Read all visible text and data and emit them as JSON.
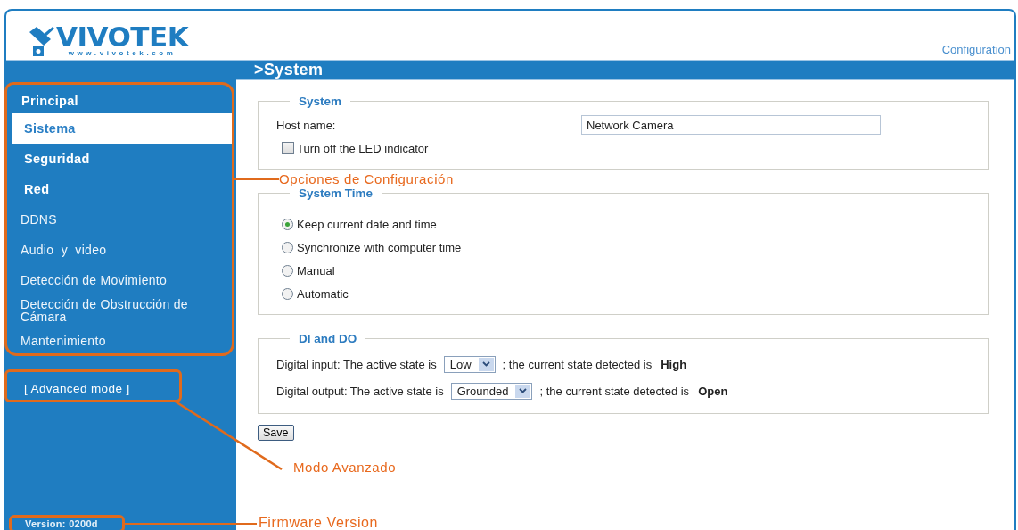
{
  "header": {
    "logo": {
      "name": "VIVOTEK",
      "url": "www.vivotek.com"
    },
    "link": "Configuration"
  },
  "title": ">System",
  "sidebar": {
    "items": [
      {
        "label": "Principal",
        "kind": "header",
        "selected": false
      },
      {
        "label": "Sistema",
        "kind": "group",
        "selected": true
      },
      {
        "label": "Seguridad",
        "kind": "group",
        "selected": false
      },
      {
        "label": "Red",
        "kind": "group",
        "selected": false
      },
      {
        "label": "DDNS",
        "kind": "link",
        "selected": false
      },
      {
        "label": "Audio  y  video",
        "kind": "link",
        "selected": false
      },
      {
        "label": "Detección de Movimiento",
        "kind": "link",
        "selected": false
      },
      {
        "label": "Detección de Obstrucción de Cámara",
        "kind": "link",
        "selected": false
      },
      {
        "label": "Mantenimiento",
        "kind": "link",
        "selected": false
      }
    ],
    "advanced_mode": "[ Advanced mode ]",
    "version": "Version: 0200d"
  },
  "sections": [
    {
      "kind": "system",
      "legend": "System",
      "host_label": "Host name:",
      "host_value": "Network Camera",
      "led": {
        "label": "Turn off the LED indicator",
        "checked": false
      }
    },
    {
      "kind": "time",
      "legend": "System Time",
      "options": [
        {
          "label": "Keep current date and time",
          "selected": true
        },
        {
          "label": "Synchronize with computer time",
          "selected": false
        },
        {
          "label": "Manual",
          "selected": false
        },
        {
          "label": "Automatic",
          "selected": false
        }
      ]
    },
    {
      "kind": "dio",
      "legend": "DI and DO",
      "rows": [
        {
          "label": "Digital input: The active state is",
          "value": "Low",
          "suffix": "; the current state detected is",
          "state": "High"
        },
        {
          "label": "Digital output: The active state is",
          "value": "Grounded",
          "suffix": "; the current state detected is",
          "state": "Open"
        }
      ]
    }
  ],
  "save": "Save",
  "annotations": [
    {
      "kind": "menu",
      "text": "Opciones de Configuración"
    },
    {
      "kind": "advanced",
      "text": "Modo Avanzado"
    },
    {
      "kind": "version",
      "text": "Firmware Version"
    }
  ]
}
